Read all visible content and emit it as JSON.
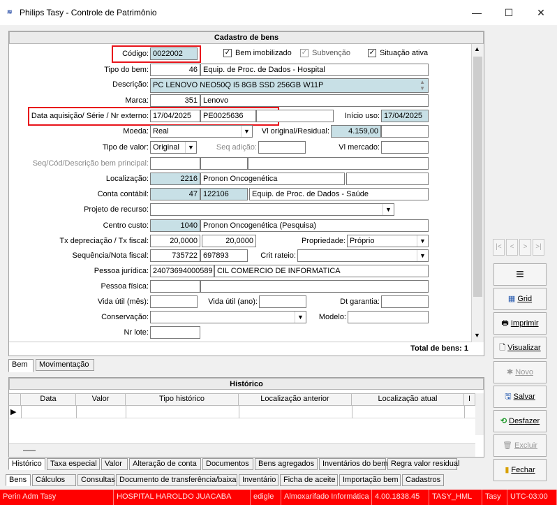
{
  "window": {
    "title": "Philips Tasy - Controle de Patrimônio",
    "app_icon": "tasy-logo",
    "minimize": "—",
    "maximize": "☐",
    "close": "✕"
  },
  "form": {
    "header": "Cadastro de bens",
    "codigo": {
      "label": "Código:",
      "value": "0022002"
    },
    "checks": {
      "bem_imobilizado": {
        "label": "Bem imobilizado",
        "checked": true
      },
      "subvencao": {
        "label": "Subvenção",
        "checked": true
      },
      "situacao_ativa": {
        "label": "Situação ativa",
        "checked": true
      }
    },
    "tipo_bem": {
      "label": "Tipo do bem:",
      "code": "46",
      "desc": "Equip. de Proc. de Dados - Hospital"
    },
    "descricao": {
      "label": "Descrição:",
      "value": "PC LENOVO NEO50Q I5 8GB SSD 256GB W11P"
    },
    "marca": {
      "label": "Marca:",
      "code": "351",
      "desc": "Lenovo"
    },
    "data_aquisicao": {
      "label": "Data aquisição/ Série / Nr externo:",
      "data": "17/04/2025",
      "serie": "PE0025636",
      "nr_externo": ""
    },
    "inicio_uso": {
      "label": "Início uso:",
      "value": "17/04/2025"
    },
    "moeda": {
      "label": "Moeda:",
      "value": "Real"
    },
    "vl_original": {
      "label": "Vl original/Residual:",
      "original": "4.159,00",
      "residual": ""
    },
    "tipo_valor": {
      "label": "Tipo de valor:",
      "value": "Original"
    },
    "seq_adicao": {
      "label": "Seq adição:",
      "value": ""
    },
    "vl_mercado": {
      "label": "Vl mercado:",
      "value": ""
    },
    "seq_principal": {
      "label": "Seq/Cód/Descrição bem principal:"
    },
    "localizacao": {
      "label": "Localização:",
      "code": "2216",
      "desc": "Pronon Oncogenética"
    },
    "conta_contabil": {
      "label": "Conta contábil:",
      "code": "47",
      "account": "122106",
      "desc": "Equip. de Proc. de Dados - Saúde"
    },
    "projeto_recurso": {
      "label": "Projeto de recurso:",
      "value": ""
    },
    "centro_custo": {
      "label": "Centro custo:",
      "code": "1040",
      "desc": "Pronon Oncogenética (Pesquisa)"
    },
    "tx_depreciacao": {
      "label": "Tx depreciação / Tx fiscal:",
      "tx": "20,0000",
      "fiscal": "20,0000"
    },
    "propriedade": {
      "label": "Propriedade:",
      "value": "Próprio"
    },
    "sequencia_nf": {
      "label": "Sequência/Nota fiscal:",
      "seq": "735722",
      "nf": "697893"
    },
    "crit_rateio": {
      "label": "Crit rateio:",
      "value": ""
    },
    "pessoa_juridica": {
      "label": "Pessoa jurídica:",
      "cnpj": "24073694000589",
      "name": "CIL COMERCIO DE INFORMATICA"
    },
    "pessoa_fisica": {
      "label": "Pessoa física:"
    },
    "vida_util_mes": {
      "label": "Vida útil (mês):"
    },
    "vida_util_ano": {
      "label": "Vida útil (ano):"
    },
    "dt_garantia": {
      "label": "Dt garantia:"
    },
    "conservacao": {
      "label": "Conservação:"
    },
    "modelo": {
      "label": "Modelo:"
    },
    "nr_lote": {
      "label": "Nr lote:"
    },
    "total": "Total de bens: 1"
  },
  "upper_tabs": [
    "Bem",
    "Movimentação"
  ],
  "historico": {
    "header": "Histórico",
    "columns": [
      "Data",
      "Valor",
      "Tipo histórico",
      "Localização anterior",
      "Localização atual",
      "I"
    ]
  },
  "lower_tabs_1": [
    "Histórico",
    "Taxa especial",
    "Valor",
    "Alteração de conta",
    "Documentos",
    "Bens agregados",
    "Inventários do bem",
    "Regra valor residual"
  ],
  "lower_tabs_2": [
    "Bens",
    "Cálculos",
    "Consultas",
    "Documento de transferência/baixa",
    "Inventário",
    "Ficha de aceite",
    "Importação bem",
    "Cadastros"
  ],
  "side_buttons": {
    "nav": [
      "|<",
      "<",
      ">",
      ">|"
    ],
    "menu": "≡",
    "grid": "Grid",
    "imprimir": "Imprimir",
    "visualizar": "Visualizar",
    "novo": "Novo",
    "salvar": "Salvar",
    "desfazer": "Desfazer",
    "excluir": "Excluir",
    "fechar": "Fechar"
  },
  "status_bar": [
    "Perin Adm Tasy",
    "HOSPITAL HAROLDO JUACABA",
    "edigle",
    "Almoxarifado Informática",
    "4.00.1838.45",
    "TASY_HML",
    "Tasy",
    "UTC-03:00"
  ],
  "colors": {
    "highlight_border": "#e8141b",
    "readonly_field": "#c8e0e6",
    "status_bar": "#ff0000"
  }
}
